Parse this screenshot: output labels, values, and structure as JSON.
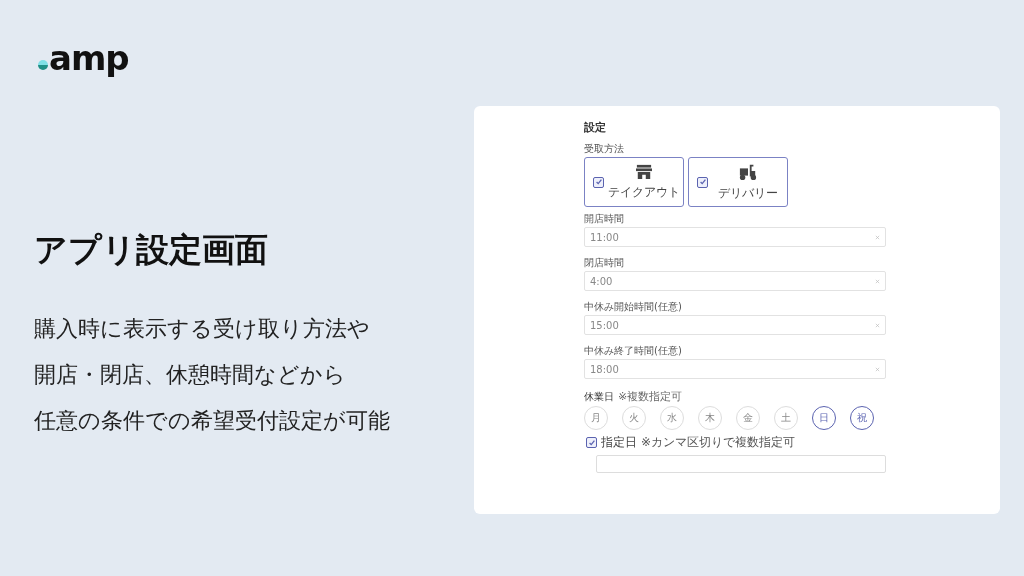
{
  "brand": {
    "name": "amp"
  },
  "headline": "アプリ設定画面",
  "description": [
    "購入時に表示する受け取り方法や",
    "開店・閉店、休憩時間などから",
    "任意の条件での希望受付設定が可能"
  ],
  "settings": {
    "title": "設定",
    "pickup": {
      "label": "受取方法",
      "options": [
        {
          "label": "テイクアウト",
          "kind": "store",
          "checked": true
        },
        {
          "label": "デリバリー",
          "kind": "scooter",
          "checked": true
        }
      ]
    },
    "fields": [
      {
        "label": "開店時間",
        "value": "11:00"
      },
      {
        "label": "閉店時間",
        "value": "4:00"
      },
      {
        "label": "中休み開始時間(任意)",
        "value": "15:00"
      },
      {
        "label": "中休み終了時間(任意)",
        "value": "18:00"
      }
    ],
    "holidays": {
      "label": "休業日",
      "note": "※複数指定可",
      "days": [
        {
          "label": "月",
          "selected": false
        },
        {
          "label": "火",
          "selected": false
        },
        {
          "label": "水",
          "selected": false
        },
        {
          "label": "木",
          "selected": false
        },
        {
          "label": "金",
          "selected": false
        },
        {
          "label": "土",
          "selected": false
        },
        {
          "label": "日",
          "selected": true
        },
        {
          "label": "祝",
          "selected": true
        }
      ]
    },
    "specific": {
      "label": "指定日",
      "note": "※カンマ区切りで複数指定可",
      "checked": true
    }
  }
}
